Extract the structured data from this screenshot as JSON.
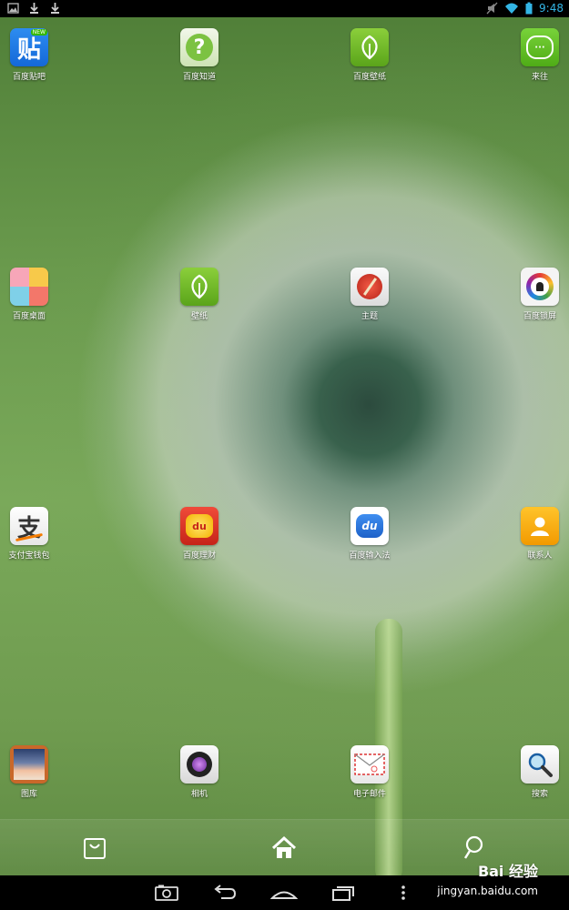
{
  "status_bar": {
    "time": "9:48",
    "left_icons": [
      "image-notification-icon",
      "download-icon",
      "download-icon"
    ],
    "right_icons": [
      "mute-icon",
      "wifi-icon",
      "battery-icon"
    ]
  },
  "apps": [
    {
      "label": "百度贴吧",
      "icon": "tieba-icon",
      "badge": "NEW",
      "glyph": "贴"
    },
    {
      "label": "百度知道",
      "icon": "zhidao-icon",
      "glyph": "?"
    },
    {
      "label": "百度壁纸",
      "icon": "wallpaper-leaf-icon"
    },
    {
      "label": "来往",
      "icon": "laiwang-chat-icon"
    },
    {
      "label": "百度桌面",
      "icon": "baidu-desktop-icon"
    },
    {
      "label": "壁纸",
      "icon": "wallpaper-icon"
    },
    {
      "label": "主题",
      "icon": "theme-brush-icon"
    },
    {
      "label": "百度锁屏",
      "icon": "lockscreen-icon"
    },
    {
      "label": "支付宝钱包",
      "icon": "alipay-icon",
      "glyph": "支"
    },
    {
      "label": "百度理财",
      "icon": "finance-icon",
      "glyph": "du"
    },
    {
      "label": "百度输入法",
      "icon": "input-method-icon",
      "glyph": "du"
    },
    {
      "label": "联系人",
      "icon": "contacts-icon"
    },
    {
      "label": "图库",
      "icon": "gallery-icon"
    },
    {
      "label": "相机",
      "icon": "camera-icon"
    },
    {
      "label": "电子邮件",
      "icon": "email-icon"
    },
    {
      "label": "搜索",
      "icon": "search-icon"
    }
  ],
  "dock": {
    "items": [
      "store-bag-icon",
      "home-icon",
      "search-icon"
    ]
  },
  "nav_bar": {
    "items": [
      "screenshot-icon",
      "back-icon",
      "home-icon",
      "recent-apps-icon",
      "menu-icon"
    ]
  },
  "watermark": {
    "brand": "Bai 经验",
    "url": "jingyan.baidu.com"
  },
  "colors": {
    "status_accent": "#33b5e5",
    "wallpaper_green": "#6a9a4d"
  }
}
